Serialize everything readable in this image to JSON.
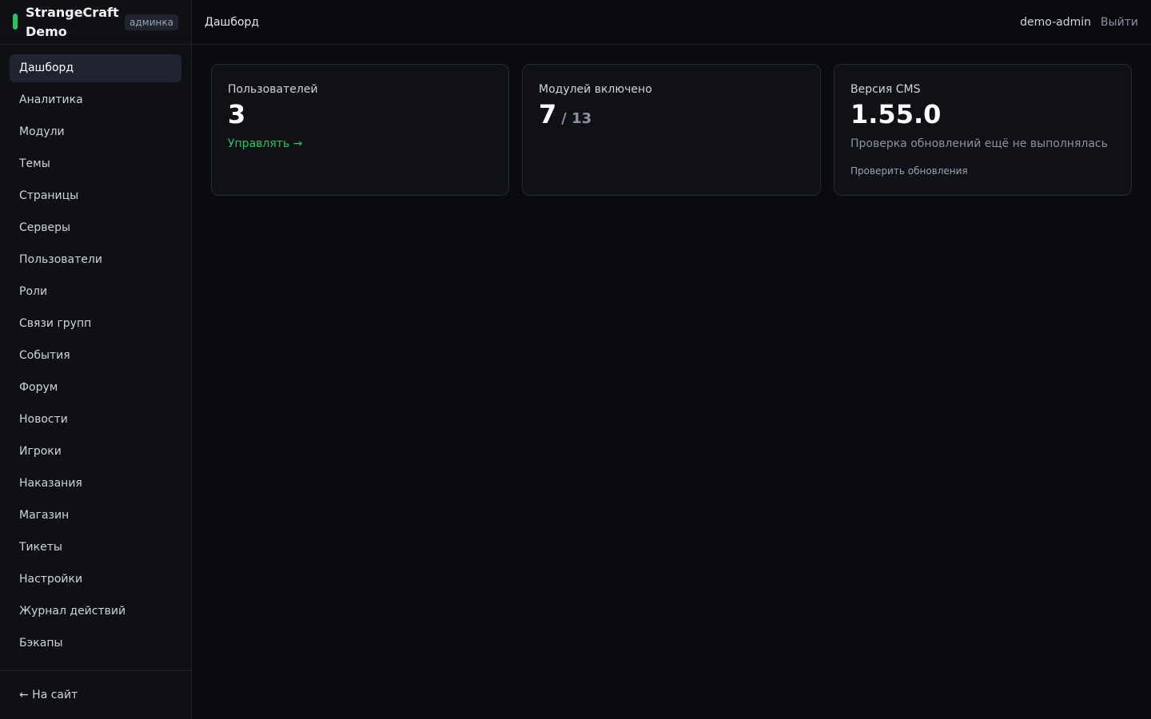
{
  "brand": {
    "name": "StrangeCraft Demo",
    "badge": "админка",
    "accent_color": "#22c55e"
  },
  "sidebar": {
    "items": [
      {
        "label": "Дашборд",
        "active": true
      },
      {
        "label": "Аналитика"
      },
      {
        "label": "Модули"
      },
      {
        "label": "Темы"
      },
      {
        "label": "Страницы"
      },
      {
        "label": "Серверы"
      },
      {
        "label": "Пользователи"
      },
      {
        "label": "Роли"
      },
      {
        "label": "Связи групп"
      },
      {
        "label": "События"
      },
      {
        "label": "Форум"
      },
      {
        "label": "Новости"
      },
      {
        "label": "Игроки"
      },
      {
        "label": "Наказания"
      },
      {
        "label": "Магазин"
      },
      {
        "label": "Тикеты"
      },
      {
        "label": "Настройки"
      },
      {
        "label": "Журнал действий"
      },
      {
        "label": "Бэкапы"
      }
    ],
    "back_link": "← На сайт"
  },
  "header": {
    "title": "Дашборд",
    "user": "demo-admin",
    "logout": "Выйти"
  },
  "cards": {
    "users": {
      "label": "Пользователей",
      "value": "3",
      "link": "Управлять →"
    },
    "modules": {
      "label": "Модулей включено",
      "value": "7",
      "total": "/ 13"
    },
    "version": {
      "label": "Версия CMS",
      "value": "1.55.0",
      "status": "Проверка обновлений ещё не выполнялась",
      "action": "Проверить обновления"
    }
  }
}
